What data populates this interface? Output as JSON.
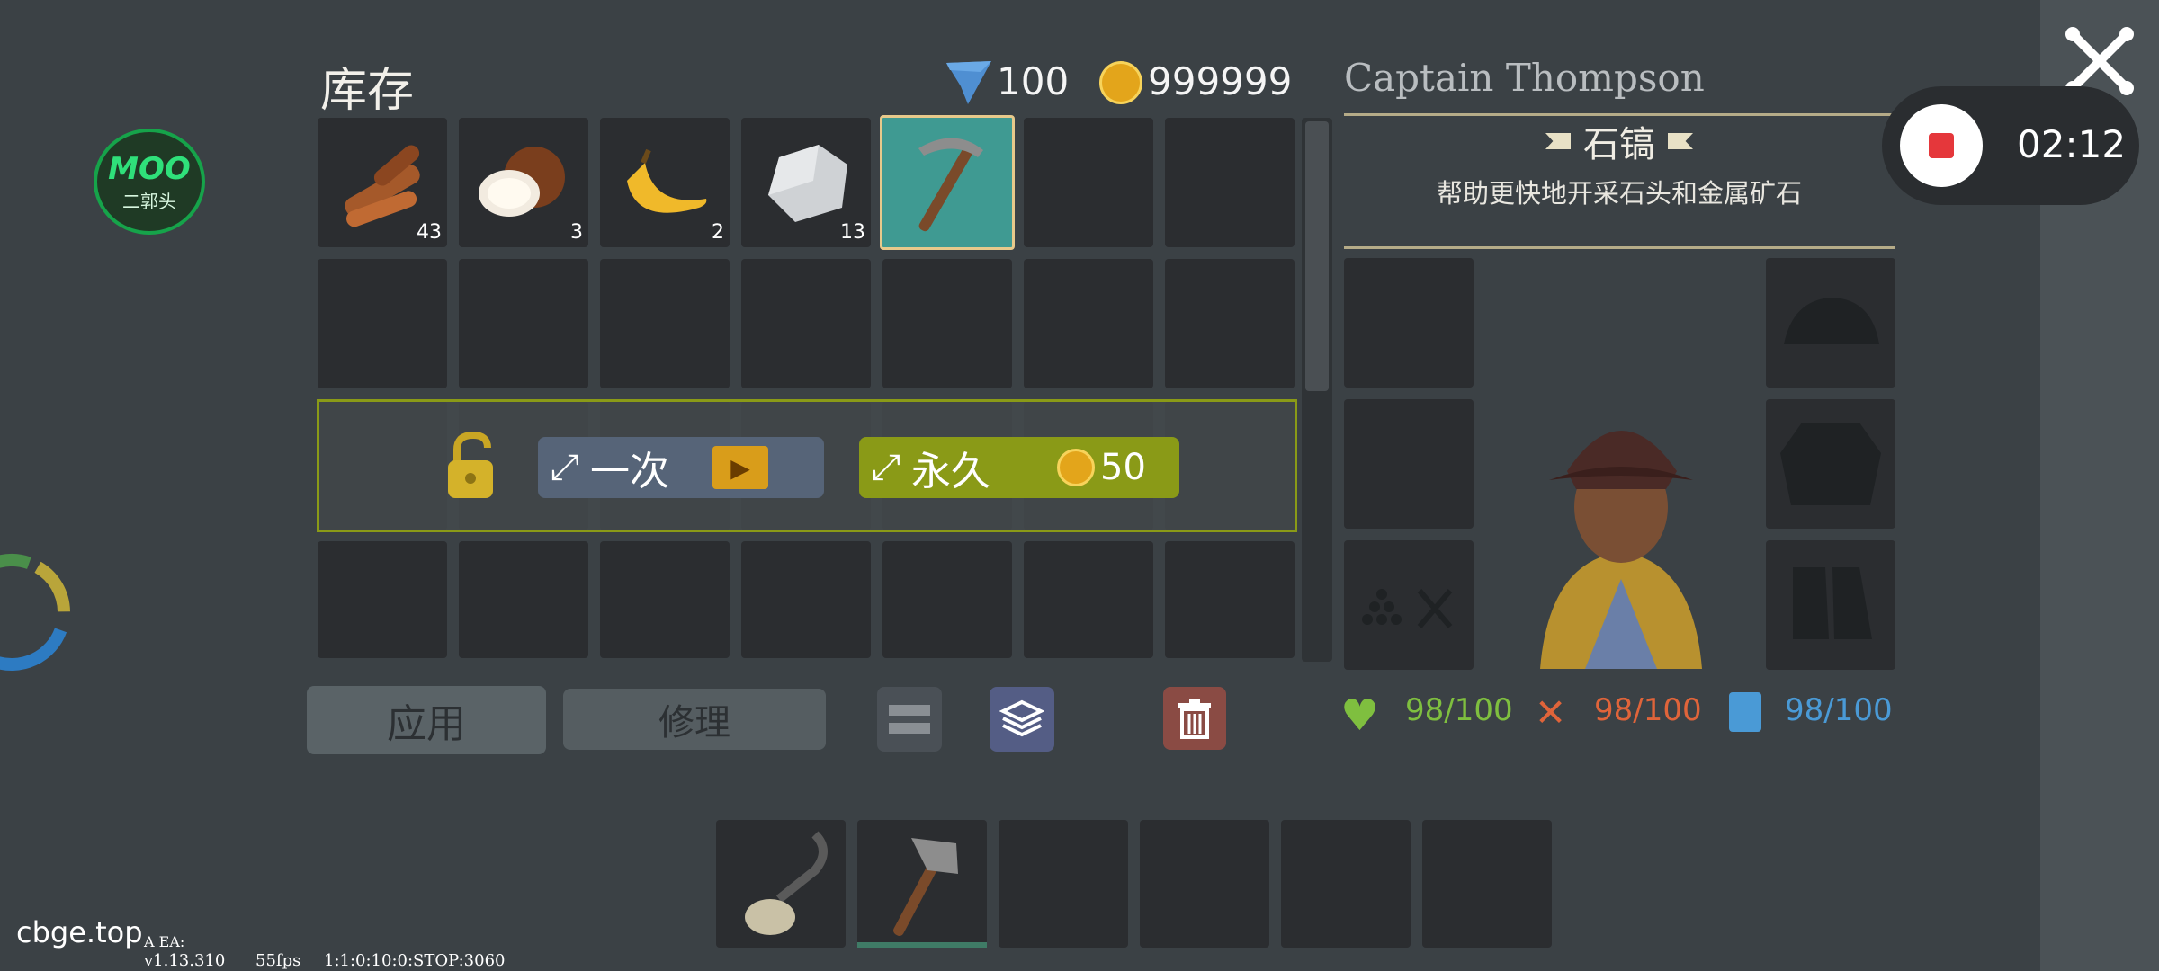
{
  "inventory": {
    "title": "库存",
    "gems": "100",
    "coins": "999999",
    "items": [
      {
        "name": "wood",
        "count": "43"
      },
      {
        "name": "coconut",
        "count": "3"
      },
      {
        "name": "banana",
        "count": "2"
      },
      {
        "name": "stone",
        "count": "13"
      },
      {
        "name": "pickaxe",
        "count": ""
      }
    ],
    "unlock": {
      "once_label": "一次",
      "permanent_label": "永久",
      "permanent_cost": "50"
    },
    "buttons": {
      "apply": "应用",
      "repair": "修理"
    }
  },
  "character": {
    "name": "Captain Thompson",
    "item_title": "石镐",
    "item_desc": "帮助更快地开采石头和金属矿石",
    "health": "98/100",
    "food": "98/100",
    "water": "98/100"
  },
  "recording": {
    "time": "02:12"
  },
  "overlay": {
    "logo_top": "MOO",
    "logo_bottom": "二郭头",
    "watermark": "cbge.top",
    "debug_label": "A EA:",
    "version": "v1.13.310",
    "fps": "55fps",
    "debug": "1:1:0:10:0:STOP:3060"
  },
  "colors": {
    "health": "#7fbf3f",
    "food": "#e0643a",
    "water": "#4a9ad6",
    "selected_slot": "#3f9a92",
    "permanent_button": "#8a9a17"
  }
}
